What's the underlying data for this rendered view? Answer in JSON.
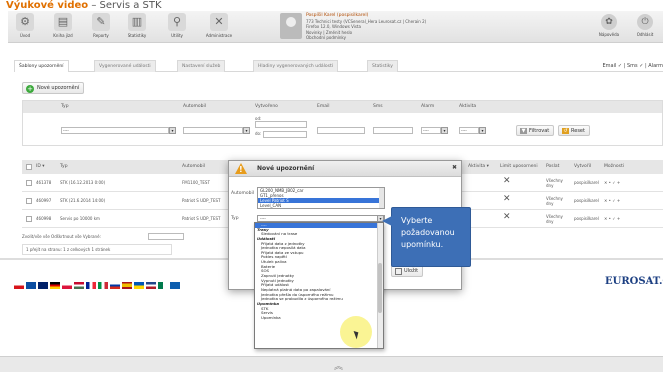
{
  "tagline": {
    "bold": "Výukové video",
    "rest": " – Servis a STK"
  },
  "toolbar": {
    "buttons": [
      {
        "label": "Úvod",
        "icon": "gear-icon"
      },
      {
        "label": "Kniha jízd",
        "icon": "book-icon"
      },
      {
        "label": "Reporty",
        "icon": "report-icon"
      },
      {
        "label": "Statistiky",
        "icon": "chart-icon"
      },
      {
        "label": "Utility",
        "icon": "search-icon"
      },
      {
        "label": "Administrace",
        "icon": "tools-icon"
      }
    ],
    "user": {
      "name": "Pospíšil Karel (pospisilkarel)",
      "line1": "773 Technici testy (VCSeneral_Hera Leurosat.cz | Cherain 2)",
      "line2": "Firefox 12.0, Windows Vista",
      "line3": "Novinky | Změnit heslo",
      "line4": "Obchodní podmínky"
    },
    "right": [
      {
        "label": "Nápověda",
        "icon": "help-icon"
      },
      {
        "label": "Odhlásit",
        "icon": "power-icon"
      }
    ]
  },
  "tabs": [
    "Šablony upozornění",
    "Vygenerované události",
    "Nastavení služeb",
    "Hladiny vygenerovaných událostí",
    "Statistiky"
  ],
  "email_sms_text": "Email ✓ | Sms ✓ | Alarm",
  "new_button": "Nové upozornění",
  "filter": {
    "headers": [
      "Typ",
      "Automobil",
      "Vytvořeno",
      "Email",
      "Sms",
      "Alarm",
      "Aktivita"
    ],
    "od_label": "od:",
    "do_label": "do:",
    "select_value": "----",
    "filter_button": "Filtrovat",
    "reset_button": "Reset"
  },
  "table": {
    "headers": [
      "ID ▾",
      "Typ",
      "Automobil",
      "Aktivita ▾",
      "Limit uposorneni",
      "Poslat",
      "Vytvořil",
      "Možnosti"
    ],
    "rows": [
      {
        "id": "461378",
        "typ": "STK (16.12.2013 0:00)",
        "auto": "FM1100_TEST",
        "poslat": "Všechny dny",
        "vytvoril": "pospisilkarel",
        "moznosti": "✕ • ✓ +"
      },
      {
        "id": "460997",
        "typ": "STK (21.6.2014 14:00)",
        "auto": "Patriot S UDP_TEST",
        "poslat": "Všechny dny",
        "vytvoril": "pospisilkarel",
        "moznosti": "✕ • ✓ +"
      },
      {
        "id": "460998",
        "typ": "Servis po 10000 km",
        "auto": "Patriot S UDP_TEST",
        "poslat": "Všechny dny",
        "vytvoril": "pospisilkarel",
        "moznosti": "✕ • ✓ +"
      }
    ],
    "bulk_label": "Zvolit/vše vše Odškrtnout vše Vybrané:",
    "pager": "1    přejít na stranu: 1    z celkových 1 stránek"
  },
  "modal": {
    "title": "Nové upozornění",
    "close": "✖",
    "automobil_label": "Automobil",
    "typ_label": "Typ",
    "vehicles": [
      "GL200_NMB_JB02_car",
      "GT1_přenos",
      "Level Patriot S",
      "Level_CAN"
    ],
    "selected_vehicle": "Level Patriot S",
    "type_value": "----",
    "save_button": "Uložit"
  },
  "dropdown": {
    "options": [
      {
        "text": "----",
        "group": false
      },
      {
        "text": "Trasy",
        "group": true
      },
      {
        "text": "Sledování na trase",
        "group": false
      },
      {
        "text": "Události",
        "group": true
      },
      {
        "text": "Přijatá data z jednotky",
        "group": false
      },
      {
        "text": "Jednotka neposílá data",
        "group": false
      },
      {
        "text": "Přijatá data ze vstupu",
        "group": false
      },
      {
        "text": "Pokles napětí",
        "group": false
      },
      {
        "text": "Útulek paliva",
        "group": false
      },
      {
        "text": "Baterie",
        "group": false
      },
      {
        "text": "SOS",
        "group": false
      },
      {
        "text": "Zapnutí jednotky",
        "group": false
      },
      {
        "text": "Vypnutí jednotky",
        "group": false
      },
      {
        "text": "Přijatá událost",
        "group": false
      },
      {
        "text": "Neplatná platná data po zapalování",
        "group": false
      },
      {
        "text": "Jednotka přešla do úsporného režimu",
        "group": false
      },
      {
        "text": "Jednotka se probudila z úsporného režimu",
        "group": false
      },
      {
        "text": "Upomínka",
        "group": true
      },
      {
        "text": "STK",
        "group": false
      },
      {
        "text": "Servis",
        "group": false
      },
      {
        "text": "Upomínka",
        "group": false
      }
    ]
  },
  "callout": "Vyberte požadovanou upomínku.",
  "brand": "EUROSAT.CZ",
  "colors": {
    "accent": "#3d6fb6",
    "warning": "#e79c1c",
    "delete": "#d23b1d",
    "brand": "#1c3f82"
  }
}
